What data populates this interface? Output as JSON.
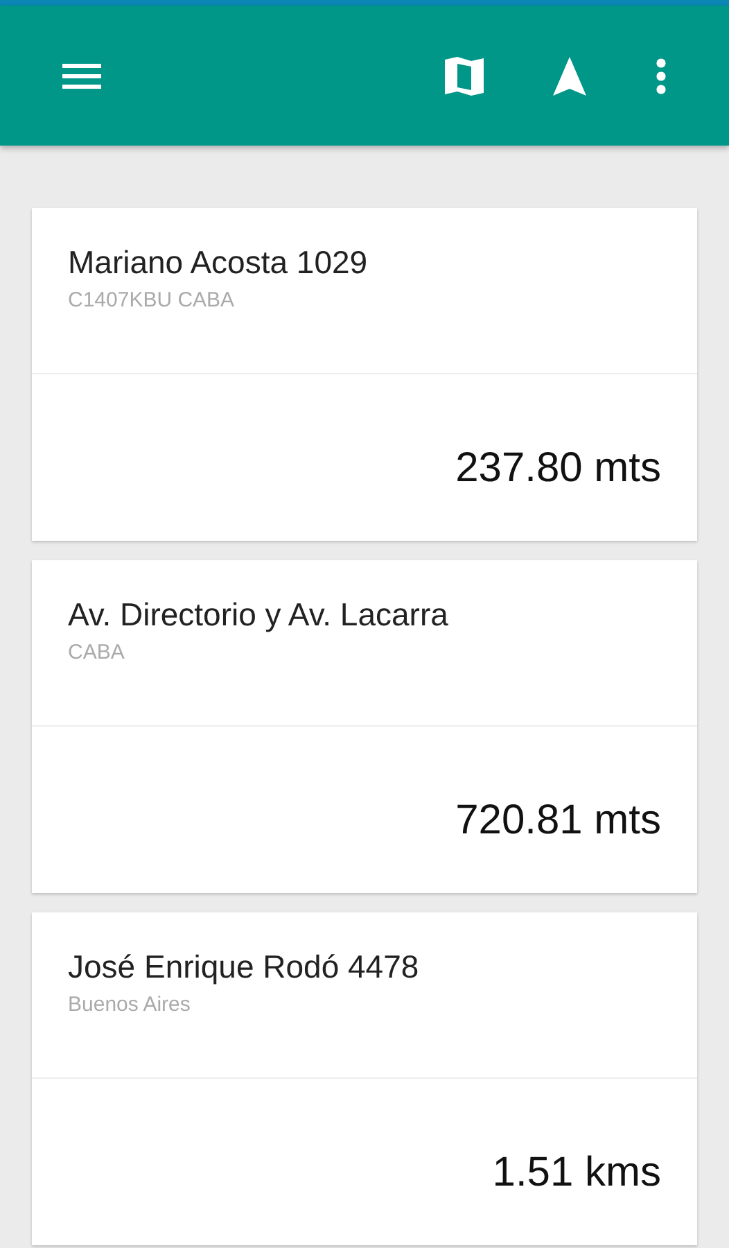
{
  "toolbar": {
    "actions": [
      {
        "kind": "map"
      },
      {
        "kind": "navigate"
      },
      {
        "kind": "more"
      }
    ]
  },
  "places": [
    {
      "name": "Mariano Acosta 1029",
      "area": "C1407KBU CABA",
      "distance": "237.80 mts"
    },
    {
      "name": "Av. Directorio y Av. Lacarra",
      "area": "CABA",
      "distance": "720.81 mts"
    },
    {
      "name": "José Enrique Rodó 4478",
      "area": "Buenos Aires",
      "distance": "1.51 kms"
    }
  ]
}
